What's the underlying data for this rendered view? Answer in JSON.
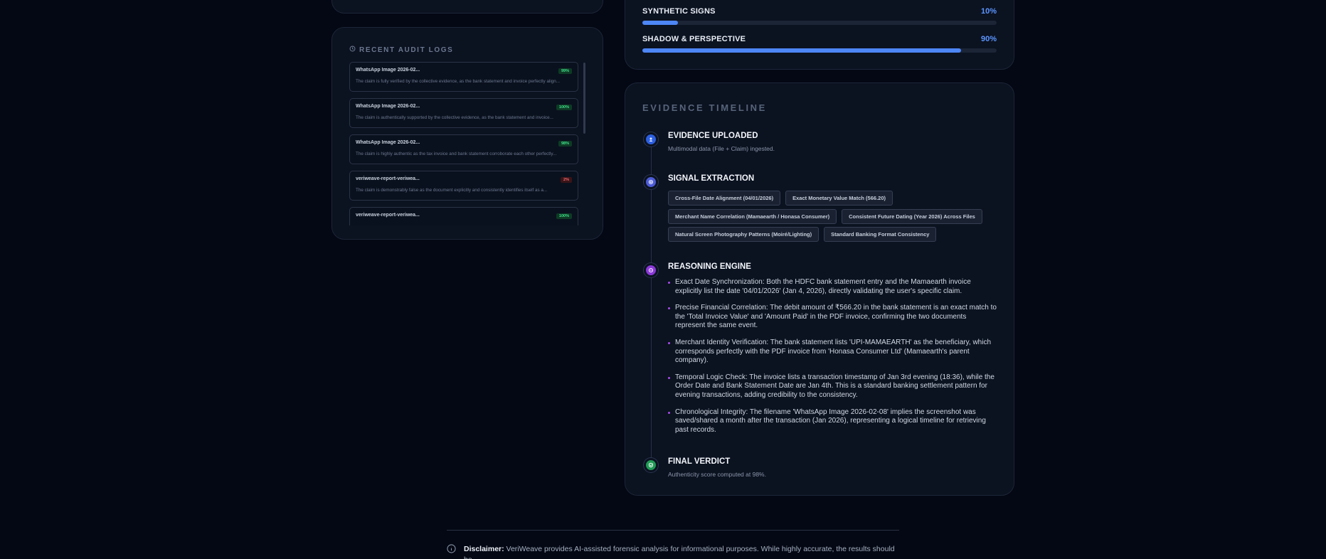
{
  "metrics": [
    {
      "label": "SYNTHETIC SIGNS",
      "value": "10%",
      "fraction": 0.1
    },
    {
      "label": "SHADOW & PERSPECTIVE",
      "value": "90%",
      "fraction": 0.9
    }
  ],
  "audit": {
    "title": "RECENT AUDIT LOGS",
    "items": [
      {
        "name": "WhatsApp Image 2026-02...",
        "badge": "99%",
        "status": "green",
        "desc": "The claim is fully verified by the collective evidence, as the bank statement and invoice perfectly align..."
      },
      {
        "name": "WhatsApp Image 2026-02...",
        "badge": "100%",
        "status": "green",
        "desc": "The claim is authentically supported by the collective evidence, as the bank statement and invoice..."
      },
      {
        "name": "WhatsApp Image 2026-02...",
        "badge": "98%",
        "status": "green",
        "desc": "The claim is highly authentic as the tax invoice and bank statement corroborate each other perfectly..."
      },
      {
        "name": "veriweave-report-veriwea...",
        "badge": "2%",
        "status": "red",
        "desc": "The claim is demonstrably false as the document explicitly and consistently identifies itself as a..."
      },
      {
        "name": "veriweave-report-veriwea...",
        "badge": "100%",
        "status": "green",
        "desc": ""
      }
    ]
  },
  "timeline": {
    "heading": "EVIDENCE TIMELINE",
    "upload": {
      "title": "EVIDENCE UPLOADED",
      "sub": "Multimodal data (File + Claim) ingested."
    },
    "signal": {
      "title": "SIGNAL EXTRACTION",
      "chips": [
        "Cross-File Date Alignment (04/01/2026)",
        "Exact Monetary Value Match (566.20)",
        "Merchant Name Correlation (Mamaearth / Honasa Consumer)",
        "Consistent Future Dating (Year 2026) Across Files",
        "Natural Screen Photography Patterns (Moiré/Lighting)",
        "Standard Banking Format Consistency"
      ]
    },
    "reasoning": {
      "title": "REASONING ENGINE",
      "items": [
        "Exact Date Synchronization: Both the HDFC bank statement entry and the Mamaearth invoice explicitly list the date '04/01/2026' (Jan 4, 2026), directly validating the user's specific claim.",
        "Precise Financial Correlation: The debit amount of ₹566.20 in the bank statement is an exact match to the 'Total Invoice Value' and 'Amount Paid' in the PDF invoice, confirming the two documents represent the same event.",
        "Merchant Identity Verification: The bank statement lists 'UPI-MAMAEARTH' as the beneficiary, which corresponds perfectly with the PDF invoice from 'Honasa Consumer Ltd' (Mamaearth's parent company).",
        "Temporal Logic Check: The invoice lists a transaction timestamp of Jan 3rd evening (18:36), while the Order Date and Bank Statement Date are Jan 4th. This is a standard banking settlement pattern for evening transactions, adding credibility to the consistency.",
        "Chronological Integrity: The filename 'WhatsApp Image 2026-02-08' implies the screenshot was saved/shared a month after the transaction (Jan 2026), representing a logical timeline for retrieving past records."
      ]
    },
    "verdict": {
      "title": "FINAL VERDICT",
      "sub": "Authenticity score computed at 98%."
    }
  },
  "disclaimer": {
    "label": "Disclaimer:",
    "text": " VeriWeave provides AI-assisted forensic analysis for informational purposes. While highly accurate, the results should be"
  },
  "colors": {
    "accent": "#4d86f5",
    "success": "#3fe08a",
    "danger": "#f06670",
    "purple": "#a54be8"
  }
}
